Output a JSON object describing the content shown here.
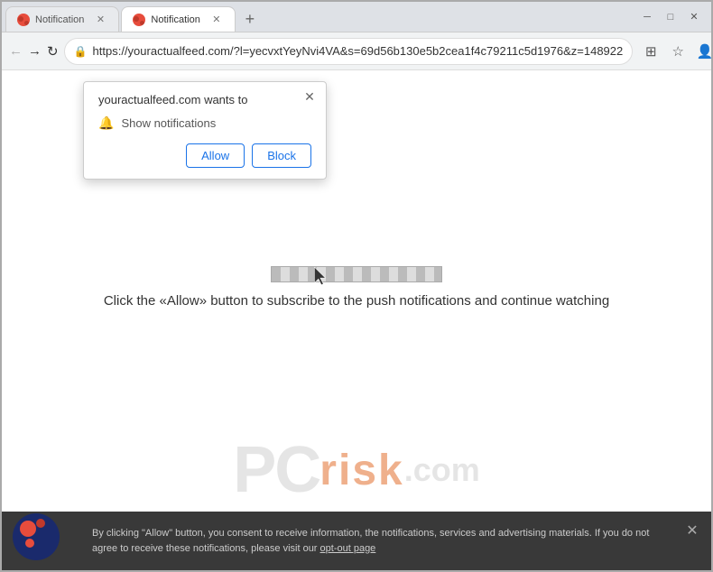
{
  "browser": {
    "tabs": [
      {
        "id": "tab1",
        "label": "Notification",
        "active": false,
        "favicon": "notification-icon"
      },
      {
        "id": "tab2",
        "label": "Notification",
        "active": true,
        "favicon": "notification-icon"
      }
    ],
    "new_tab_label": "+",
    "window_controls": {
      "minimize": "─",
      "maximize": "□",
      "close": "✕"
    },
    "address_bar": {
      "url": "https://youractualfeed.com/?l=yecvxtYeyNvi4VA&s=69d56b130e5b2cea1f4c79211c5d1976&z=148922",
      "lock_icon": "🔒"
    },
    "nav": {
      "back": "←",
      "forward": "→",
      "reload": "↻"
    }
  },
  "notification_popup": {
    "title": "youractualfeed.com wants to",
    "permission_label": "Show notifications",
    "allow_button": "Allow",
    "block_button": "Block",
    "close_icon": "✕"
  },
  "page": {
    "loading_bar_visible": true,
    "main_message": "Click the «Allow» button to subscribe to the push notifications and continue watching"
  },
  "footer": {
    "text_before_link": "By clicking \"Allow\" button, you consent to receive information, the notifications, services and advertising materials. If you do not agree to receive these notifications, please visit our ",
    "link_text": "opt-out page",
    "text_after_link": "",
    "close_icon": "✕"
  },
  "watermark": {
    "pc_text": "PC",
    "risk_text": "risk",
    "com_text": ".com"
  }
}
